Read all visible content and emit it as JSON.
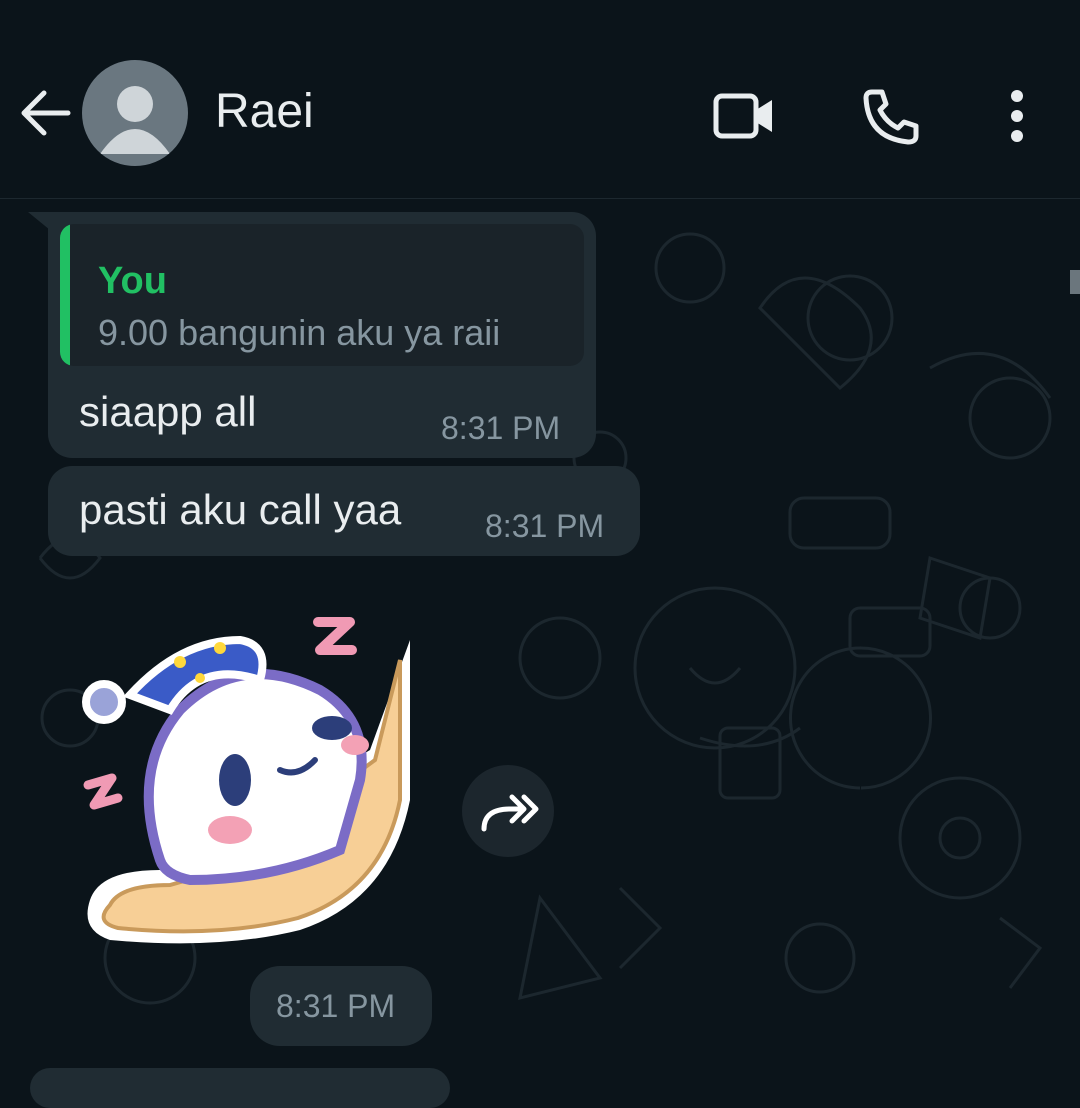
{
  "header": {
    "contact_name": "Raei",
    "icons": [
      "back-arrow-icon",
      "avatar-placeholder",
      "video-call-icon",
      "voice-call-icon",
      "more-options-icon"
    ]
  },
  "messages": [
    {
      "type": "text",
      "quoted": {
        "author": "You",
        "text": "9.00 bangunin aku ya raii"
      },
      "text": "siaapp all",
      "time": "8:31 PM"
    },
    {
      "type": "text",
      "text": "pasti aku call yaa",
      "time": "8:31 PM"
    },
    {
      "type": "sticker",
      "sticker": "sleeping-ghost-sticker",
      "time": "8:31 PM"
    }
  ],
  "colors": {
    "background": "#0b141a",
    "bubble": "#202c33",
    "accent_green": "#21c063",
    "text_primary": "#e9edef",
    "text_secondary": "#8696a0"
  }
}
